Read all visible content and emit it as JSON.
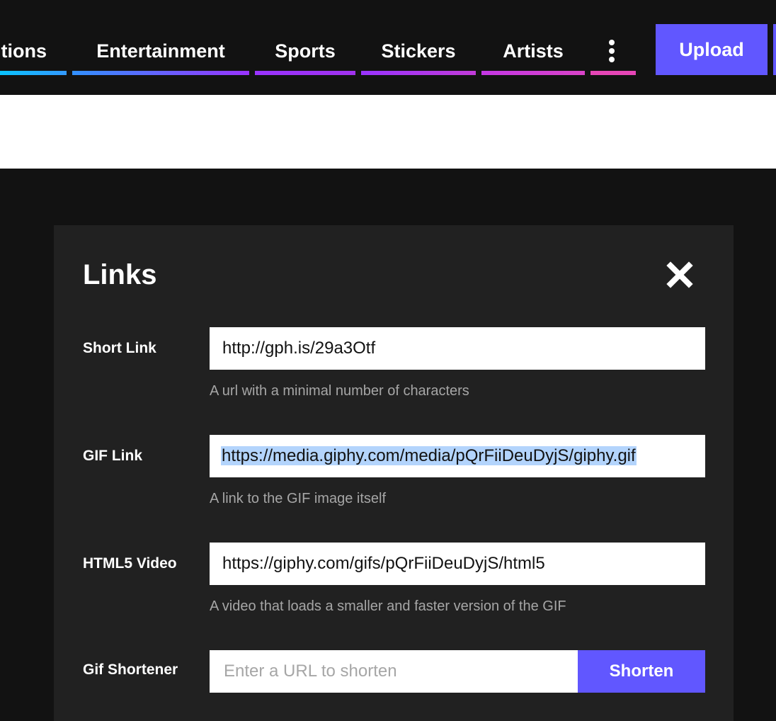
{
  "nav": {
    "items": [
      {
        "label": "Reactions",
        "visible_text": "tions",
        "color_start": "#00ccff",
        "color_end": "#3399ff"
      },
      {
        "label": "Entertainment",
        "color_start": "#3191ff",
        "color_end": "#9933ff"
      },
      {
        "label": "Sports",
        "color_start": "#9933ff",
        "color_end": "#a032ee"
      },
      {
        "label": "Stickers",
        "color_start": "#9933ff",
        "color_end": "#c13bd8"
      },
      {
        "label": "Artists",
        "color_start": "#c437e4",
        "color_end": "#d943c8"
      }
    ],
    "more_icon": "vertical-ellipsis-icon",
    "more_color": "#e646b6",
    "upload_label": "Upload",
    "accent": "#6157ff"
  },
  "modal": {
    "title": "Links",
    "close_icon": "close-icon",
    "fields": [
      {
        "label": "Short Link",
        "value": "http://gph.is/29a3Otf",
        "help": "A url with a minimal number of characters"
      },
      {
        "label": "GIF Link",
        "value": "https://media.giphy.com/media/pQrFiiDeuDyjS/giphy.gif",
        "help": "A link to the GIF image itself",
        "selected": true
      },
      {
        "label": "HTML5 Video",
        "value": "https://giphy.com/gifs/pQrFiiDeuDyjS/html5",
        "help": "A video that loads a smaller and faster version of the GIF"
      }
    ],
    "shortener": {
      "label": "Gif Shortener",
      "placeholder": "Enter a URL to shorten",
      "button_label": "Shorten"
    }
  }
}
